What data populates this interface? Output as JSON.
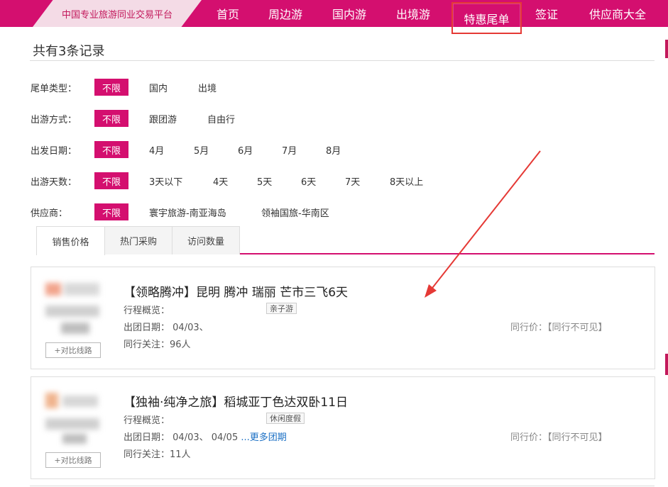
{
  "header": {
    "brand": "中国专业旅游同业交易平台",
    "nav": [
      "首页",
      "周边游",
      "国内游",
      "出境游",
      "特惠尾单",
      "签证",
      "供应商大全"
    ],
    "active_index": 4,
    "brand_color": "#d40f6f",
    "highlight_color": "#e53935"
  },
  "summary": {
    "records": "共有3条记录"
  },
  "filters": [
    {
      "label": "尾单类型：",
      "options": [
        "不限",
        "国内",
        "出境"
      ]
    },
    {
      "label": "出游方式：",
      "options": [
        "不限",
        "跟团游",
        "自由行"
      ]
    },
    {
      "label": "出发日期：",
      "options": [
        "不限",
        "4月",
        "5月",
        "6月",
        "7月",
        "8月"
      ]
    },
    {
      "label": "出游天数：",
      "options": [
        "不限",
        "3天以下",
        "4天",
        "5天",
        "6天",
        "7天",
        "8天以上"
      ]
    },
    {
      "label": "供应商：",
      "options": [
        "不限",
        "寰宇旅游-南亚海岛",
        "领袖国旅-华南区"
      ]
    }
  ],
  "tabs": [
    "销售价格",
    "热门采购",
    "访问数量"
  ],
  "products": [
    {
      "title": "【领略腾冲】昆明 腾冲 瑞丽 芒市三飞6天",
      "overview_label": "行程概览：",
      "tag": "亲子游",
      "dates_label": "出团日期：",
      "dates": "04/03、",
      "more_dates": "",
      "followers_label": "同行关注：",
      "followers": "96人",
      "peer_price": "同行价：【同行不可见】",
      "compare": "+对比线路"
    },
    {
      "title": "【独袖·纯净之旅】稻城亚丁色达双卧11日",
      "overview_label": "行程概览：",
      "tag": "休闲度假",
      "dates_label": "出团日期：",
      "dates": "04/03、 04/05",
      "more_dates": "...更多团期",
      "followers_label": "同行关注：",
      "followers": "11人",
      "peer_price": "同行价：【同行不可见】",
      "compare": "+对比线路"
    }
  ]
}
